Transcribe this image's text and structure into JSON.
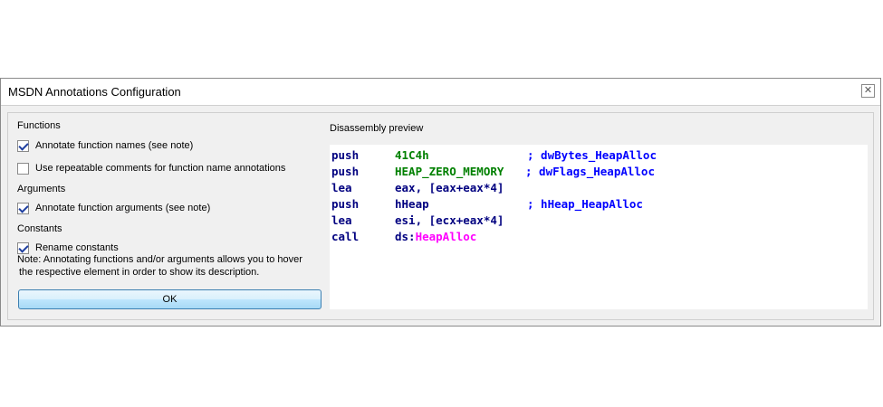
{
  "window": {
    "title": "MSDN Annotations Configuration",
    "close_symbol": "✕"
  },
  "sections": {
    "functions": "Functions",
    "arguments": "Arguments",
    "constants": "Constants"
  },
  "options": {
    "annotate_function_names": {
      "label": "Annotate function names (see note)",
      "checked": true
    },
    "repeatable_comments": {
      "label": "Use repeatable comments for function name annotations",
      "checked": false
    },
    "annotate_function_arguments": {
      "label": "Annotate function arguments (see note)",
      "checked": true
    },
    "rename_constants": {
      "label": "Rename constants",
      "checked": true
    }
  },
  "note": {
    "line1": "Note: Annotating functions and/or arguments allows you to hover",
    "line2": "the respective element in order to show its description."
  },
  "ok_label": "OK",
  "preview": {
    "label": "Disassembly preview",
    "lines": [
      {
        "mnemonic": "push",
        "operand": "41C4h",
        "operand_color": "#008000",
        "comment": "; dwBytes_HeapAlloc"
      },
      {
        "mnemonic": "push",
        "operand": "HEAP_ZERO_MEMORY",
        "operand_color": "#008000",
        "comment": "; dwFlags_HeapAlloc"
      },
      {
        "mnemonic": "lea",
        "operand": "eax, [eax+eax*4]",
        "operand_color": "#000080",
        "comment": ""
      },
      {
        "mnemonic": "push",
        "operand": "hHeap",
        "operand_color": "#000080",
        "comment": "; hHeap_HeapAlloc"
      },
      {
        "mnemonic": "lea",
        "operand": "esi, [ecx+eax*4]",
        "operand_color": "#000080",
        "comment": ""
      },
      {
        "mnemonic": "call",
        "operand_prefix": "ds:",
        "operand": "HeapAlloc",
        "operand_color": "#ff00ff",
        "comment": ""
      }
    ],
    "colors": {
      "mnemonic": "#000080",
      "comment": "#0000ff"
    }
  }
}
